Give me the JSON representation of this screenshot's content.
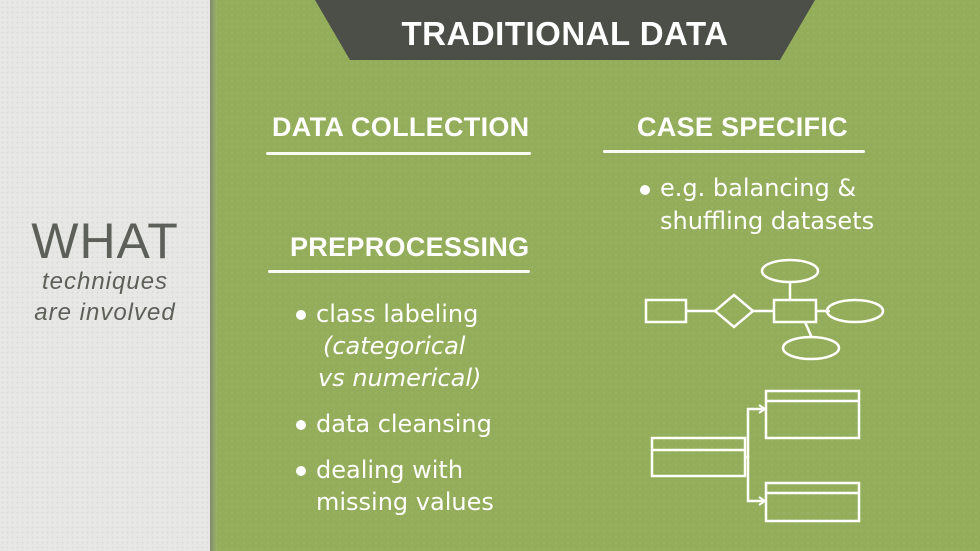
{
  "banner": {
    "title": "TRADITIONAL DATA"
  },
  "sidebar": {
    "title": "WHAT",
    "subtitle_line1": "techniques",
    "subtitle_line2": "are involved"
  },
  "sections": {
    "data_collection": {
      "heading": "DATA COLLECTION"
    },
    "preprocessing": {
      "heading": "PREPROCESSING",
      "bullets": [
        {
          "line1": "class labeling",
          "line2": "(categorical",
          "line3": "vs numerical)"
        },
        {
          "line1": "data cleansing"
        },
        {
          "line1": "dealing with",
          "line2": "missing values"
        }
      ]
    },
    "case_specific": {
      "heading": "CASE SPECIFIC",
      "bullets": [
        {
          "line1": "e.g. balancing &",
          "line2": "shuffling datasets"
        }
      ]
    }
  },
  "icons": {
    "diagram_1": "entity-relationship-diagram-icon",
    "diagram_2": "table-hierarchy-diagram-icon"
  },
  "colors": {
    "background": "#93ad5a",
    "sidebar": "#e7e7e5",
    "banner": "#4b4f47",
    "text": "#ffffff",
    "sidebar_text": "#5d6058"
  }
}
